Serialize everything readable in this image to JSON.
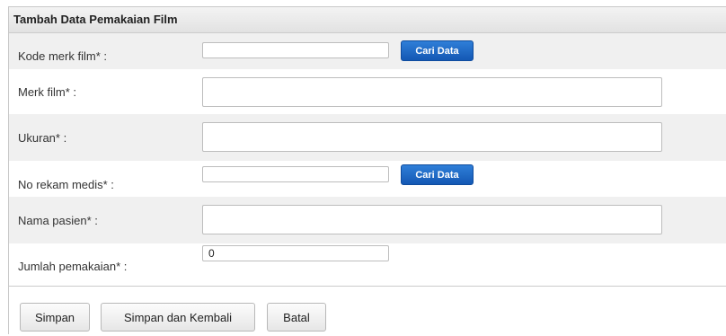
{
  "form": {
    "title": "Tambah Data Pemakaian Film",
    "fields": [
      {
        "label": "Kode merk film* :",
        "value": "",
        "button": "Cari Data"
      },
      {
        "label": "Merk film* :",
        "value": ""
      },
      {
        "label": "Ukuran* :",
        "value": ""
      },
      {
        "label": "No rekam medis* :",
        "value": "",
        "button": "Cari Data"
      },
      {
        "label": "Nama pasien* :",
        "value": ""
      },
      {
        "label": "Jumlah pemakaian* :",
        "value": "0"
      }
    ]
  },
  "actions": {
    "save": "Simpan",
    "save_back": "Simpan dan Kembali",
    "cancel": "Batal"
  },
  "colors": {
    "accent_button": "#1c66c4",
    "row_shade": "#f0f0f0",
    "header_bg": "#e8e8e8"
  }
}
